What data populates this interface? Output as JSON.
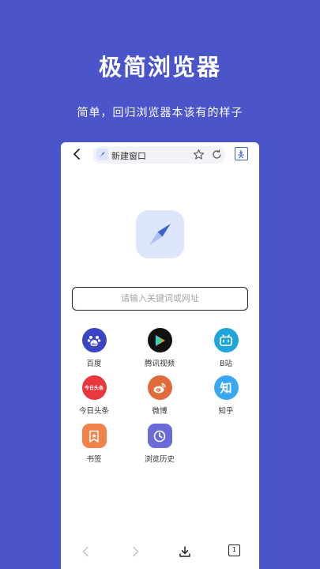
{
  "promo": {
    "title": "极简浏览器",
    "subtitle": "简单，回归浏览器本该有的样子"
  },
  "address_bar": {
    "tab_title": "新建窗口"
  },
  "search": {
    "placeholder": "请输入关键词或网址"
  },
  "shortcuts": [
    {
      "label": "百度",
      "icon": "baidu-icon",
      "color": "#3b45c4"
    },
    {
      "label": "腾讯视频",
      "icon": "tencent-video-icon",
      "color": "#111111"
    },
    {
      "label": "B站",
      "icon": "bilibili-icon",
      "color": "#21a4d9"
    },
    {
      "label": "今日头条",
      "icon": "toutiao-icon",
      "color": "#e8383d",
      "icon_text": "今日头条"
    },
    {
      "label": "微博",
      "icon": "weibo-icon",
      "color": "#e06a3a"
    },
    {
      "label": "知乎",
      "icon": "zhihu-icon",
      "color": "#3aa8f0",
      "icon_text": "知"
    },
    {
      "label": "书签",
      "icon": "bookmark-icon",
      "color": "#f0824a"
    },
    {
      "label": "浏览历史",
      "icon": "history-icon",
      "color": "#6b6bd8"
    }
  ],
  "toolbar": {
    "tab_count": "1"
  },
  "colors": {
    "background": "#4a55c9",
    "accent": "#3b66c7"
  }
}
